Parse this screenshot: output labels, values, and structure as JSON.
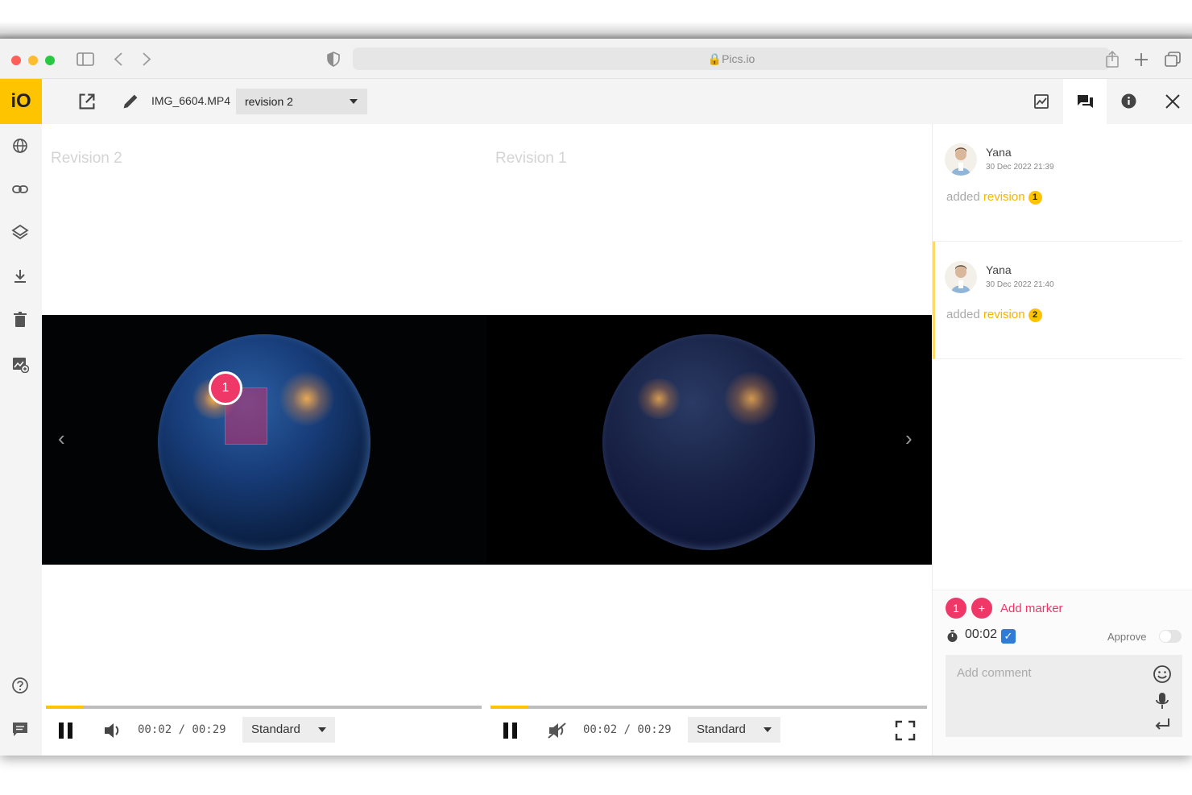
{
  "browser": {
    "url": "Pics.io",
    "traffic_colors": [
      "#fe5f57",
      "#febc2e",
      "#28c840"
    ]
  },
  "app": {
    "logo": "iO",
    "accent": "#ffc400",
    "filename": "IMG_6604.MP4",
    "revision_select": "revision 2"
  },
  "viewer": {
    "left_label": "Revision 2",
    "right_label": "Revision 1",
    "left": {
      "marker_number": "1",
      "time": "00:02 / 00:29",
      "speed": "Standard",
      "progress": 0.085
    },
    "right": {
      "time": "00:02 / 00:29",
      "speed": "Standard",
      "progress": 0.085
    }
  },
  "comments": [
    {
      "name": "Yana",
      "date": "30 Dec 2022 21:39",
      "text": "added",
      "link": "revision",
      "badge": "1"
    },
    {
      "name": "Yana",
      "date": "30 Dec 2022 21:40",
      "text": "added",
      "link": "revision",
      "badge": "2"
    }
  ],
  "composer": {
    "marker_count": "1",
    "plus": "+",
    "add_marker": "Add marker",
    "timecode": "00:02",
    "check": "✓",
    "approve": "Approve",
    "placeholder": "Add comment"
  }
}
